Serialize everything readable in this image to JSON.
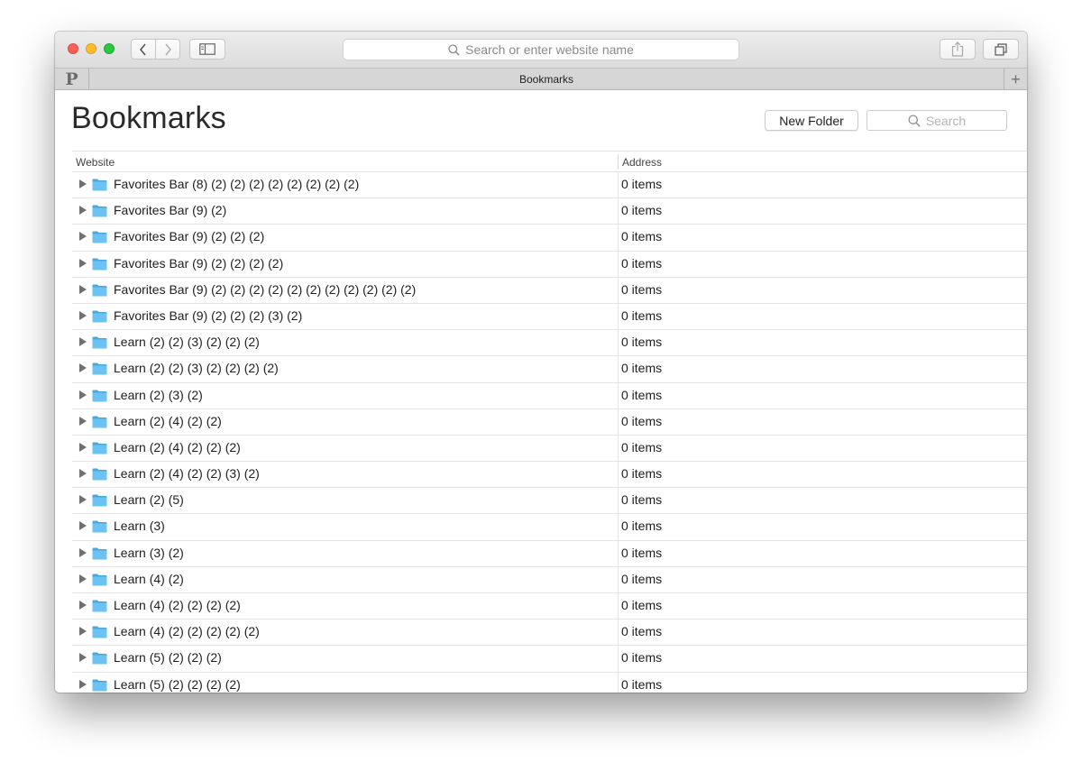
{
  "address_bar": {
    "placeholder": "Search or enter website name"
  },
  "tab": {
    "pinned_letter": "P",
    "title": "Bookmarks",
    "new_tab": "+"
  },
  "page": {
    "title": "Bookmarks",
    "new_folder_label": "New Folder",
    "search_placeholder": "Search"
  },
  "table": {
    "columns": [
      "Website",
      "Address"
    ],
    "rows": [
      {
        "name": "Favorites Bar (8) (2) (2) (2) (2) (2) (2) (2) (2)",
        "address": "0 items"
      },
      {
        "name": "Favorites Bar (9) (2)",
        "address": "0 items"
      },
      {
        "name": "Favorites Bar (9) (2) (2) (2)",
        "address": "0 items"
      },
      {
        "name": "Favorites Bar (9) (2) (2) (2) (2)",
        "address": "0 items"
      },
      {
        "name": "Favorites Bar (9) (2) (2) (2) (2) (2) (2) (2) (2) (2) (2) (2)",
        "address": "0 items"
      },
      {
        "name": "Favorites Bar (9) (2) (2) (2) (3) (2)",
        "address": "0 items"
      },
      {
        "name": "Learn (2) (2) (3) (2) (2) (2)",
        "address": "0 items"
      },
      {
        "name": "Learn (2) (2) (3) (2) (2) (2) (2)",
        "address": "0 items"
      },
      {
        "name": "Learn (2) (3) (2)",
        "address": "0 items"
      },
      {
        "name": "Learn (2) (4) (2) (2)",
        "address": "0 items"
      },
      {
        "name": "Learn (2) (4) (2) (2) (2)",
        "address": "0 items"
      },
      {
        "name": "Learn (2) (4) (2) (2) (3) (2)",
        "address": "0 items"
      },
      {
        "name": "Learn (2) (5)",
        "address": "0 items"
      },
      {
        "name": "Learn (3)",
        "address": "0 items"
      },
      {
        "name": "Learn (3) (2)",
        "address": "0 items"
      },
      {
        "name": "Learn (4) (2)",
        "address": "0 items"
      },
      {
        "name": "Learn (4) (2) (2) (2) (2)",
        "address": "0 items"
      },
      {
        "name": "Learn (4) (2) (2) (2) (2) (2)",
        "address": "0 items"
      },
      {
        "name": "Learn (5) (2) (2) (2)",
        "address": "0 items"
      },
      {
        "name": "Learn (5) (2) (2) (2) (2)",
        "address": "0 items"
      }
    ]
  },
  "colors": {
    "close": "#fc5f57",
    "minimize": "#fdbc2e",
    "zoom": "#28c840",
    "folder": "#6cc2f2"
  },
  "icons": [
    "back-icon",
    "forward-icon",
    "sidebar-icon",
    "search-icon",
    "share-icon",
    "tabs-overview-icon",
    "folder-icon",
    "disclosure-triangle-icon"
  ]
}
